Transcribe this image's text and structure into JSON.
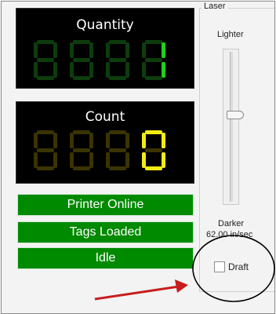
{
  "quantity": {
    "title": "Quantity",
    "digits": [
      "8",
      "8",
      "8",
      "1"
    ],
    "on_color": "#1fd11f",
    "off_color": "#0d3d0d"
  },
  "count": {
    "title": "Count",
    "digits": [
      "8",
      "8",
      "8",
      "0"
    ],
    "on_color": "#f1ec14",
    "off_color": "#3b3400"
  },
  "status": {
    "items": [
      "Printer Online",
      "Tags Loaded",
      "Idle"
    ],
    "color": "#008a00"
  },
  "laser": {
    "legend": "Laser",
    "lighter_label": "Lighter",
    "darker_label": "Darker",
    "speed": "62.00 in/sec",
    "draft_label": "Draft",
    "draft_checked": false
  },
  "annotation": {
    "arrow_color": "#c81d1d",
    "circle_color": "#000000"
  }
}
